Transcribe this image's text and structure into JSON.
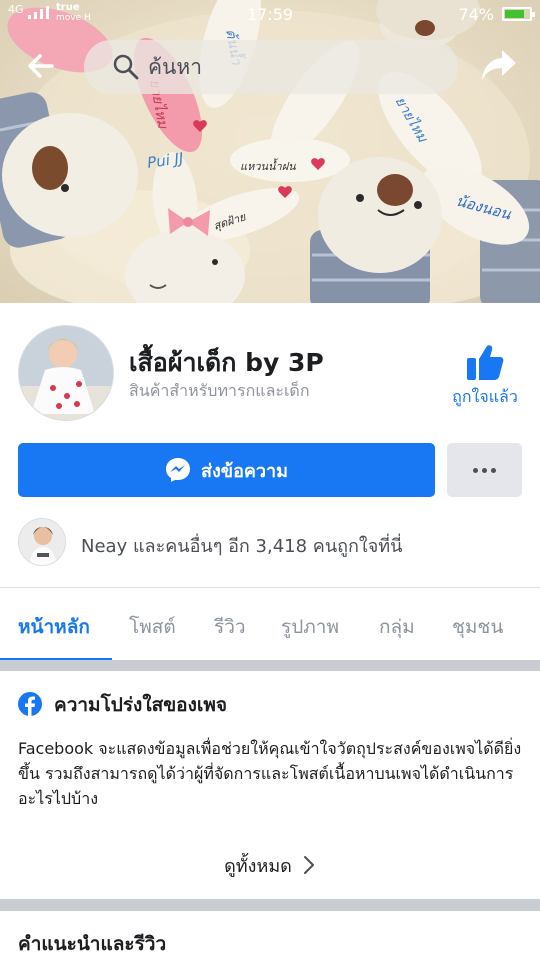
{
  "status_bar": {
    "signal_label": "4G",
    "carrier_line1": "true",
    "carrier_line2": "move H",
    "time": "17:59",
    "battery_percent": "74%",
    "battery_level": 0.74
  },
  "header": {
    "search_placeholder": "ค้นหา",
    "back_icon": "arrow-left-icon",
    "share_icon": "share-arrow-icon"
  },
  "cover": {
    "tag_texts": [
      "Pui JJ",
      "ยายไหม",
      "ต้นน้ำ",
      "น้องนอน",
      "แหวนน้ำฝน",
      "สุดฝ้าย"
    ]
  },
  "page": {
    "name": "เสื้อผ้าเด็ก by 3P",
    "category": "สินค้าสำหรับทารกและเด็ก",
    "like_label": "ถูกใจแล้ว",
    "message_label": "ส่งข้อความ",
    "likes_summary": "Neay และคนอื่นๆ อีก 3,418 คนถูกใจที่นี่"
  },
  "tabs": [
    {
      "label": "หน้าหลัก",
      "active": true
    },
    {
      "label": "โพสต์",
      "active": false
    },
    {
      "label": "รีวิว",
      "active": false
    },
    {
      "label": "รูปภาพ",
      "active": false
    },
    {
      "label": "กลุ่ม",
      "active": false
    },
    {
      "label": "ชุมชน",
      "active": false
    }
  ],
  "transparency": {
    "title": "ความโปร่งใสของเพจ",
    "body": "Facebook จะแสดงข้อมูลเพื่อช่วยให้คุณเข้าใจวัตถุประสงค์ของเพจได้ดียิ่งขึ้น รวมถึงสามารถดูได้ว่าผู้ที่จัดการและโพสต์เนื้อหาบนเพจได้ดำเนินการอะไรไปบ้าง",
    "see_all": "ดูทั้งหมด"
  },
  "reviews": {
    "title": "คำแนะนำและรีวิว"
  },
  "colors": {
    "accent": "#1877f2",
    "separator": "#c9ccd1",
    "secondary_text": "#90949c"
  }
}
